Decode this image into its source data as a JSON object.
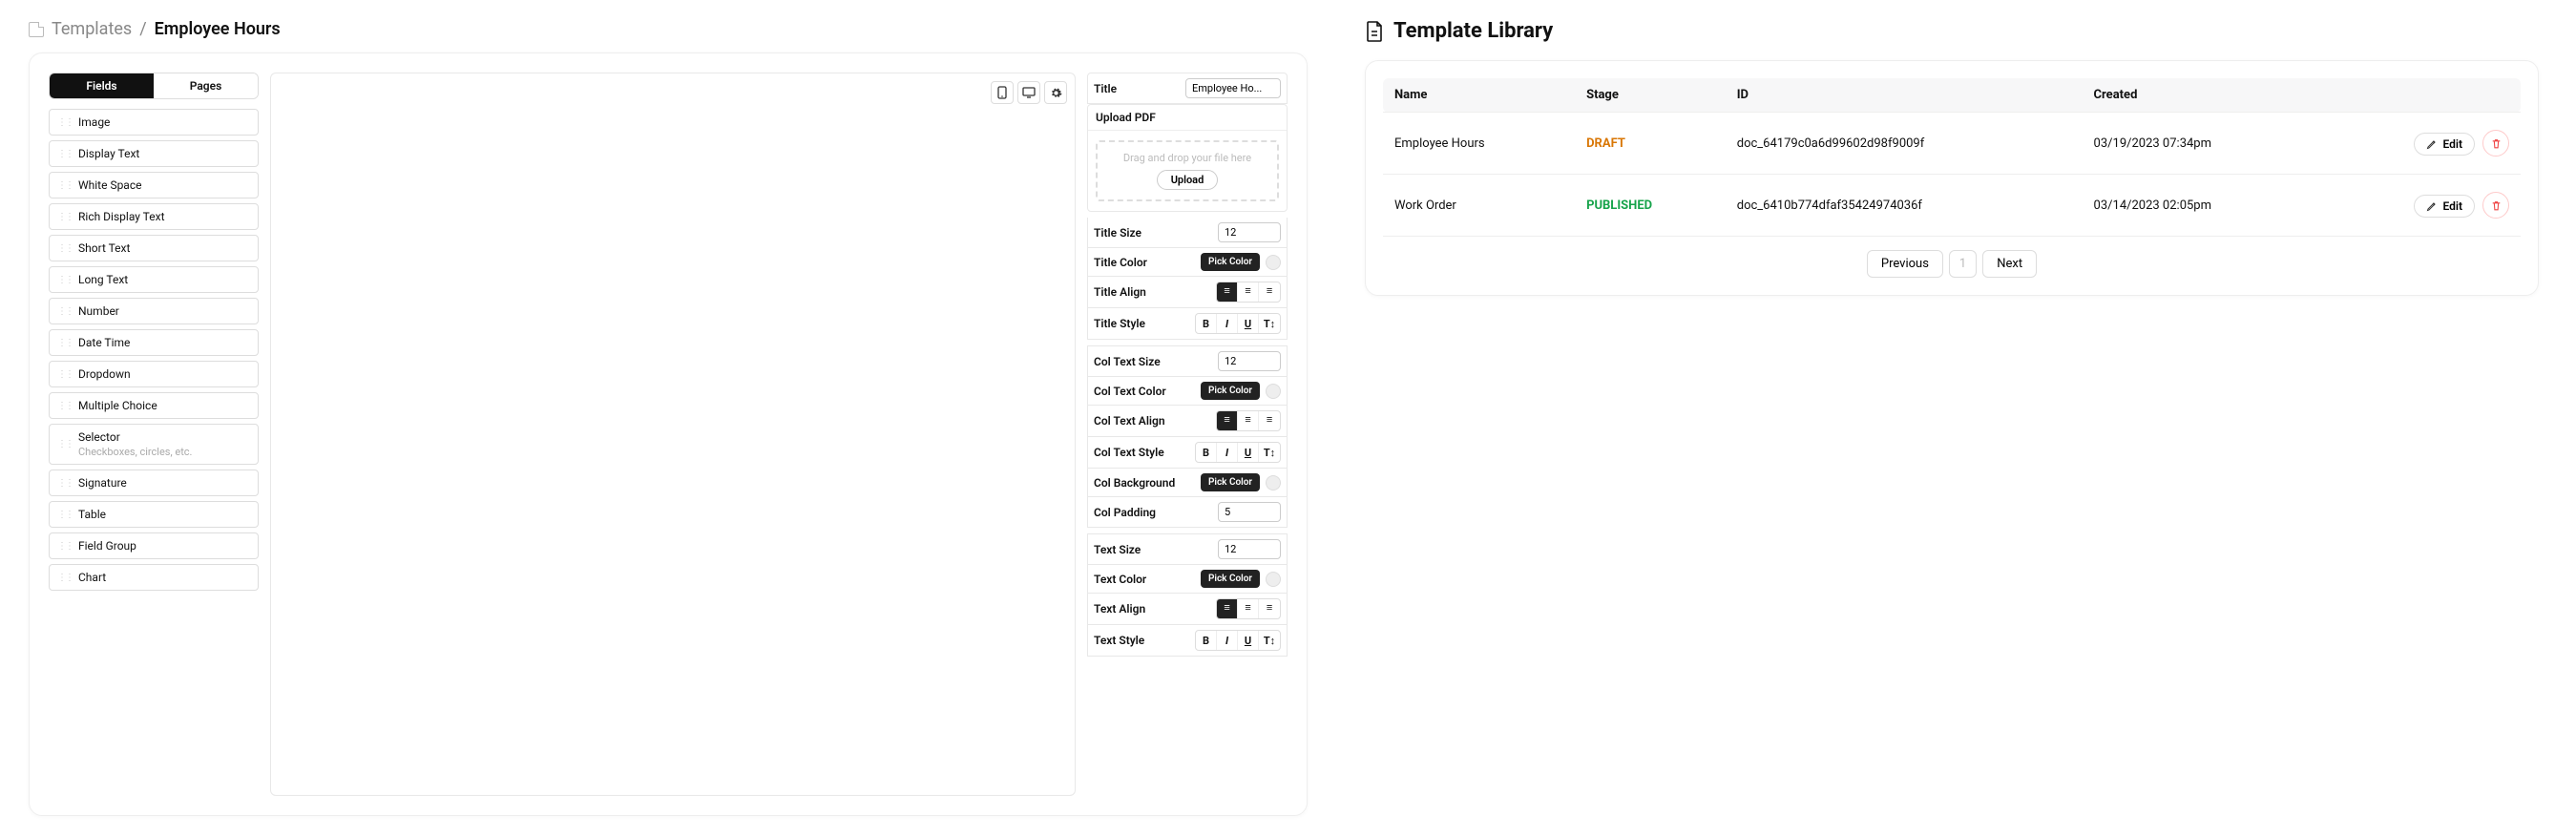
{
  "breadcrumb": {
    "root": "Templates",
    "sep": "/",
    "current": "Employee Hours"
  },
  "tabs": [
    "Fields",
    "Pages"
  ],
  "fields": [
    {
      "label": "Image"
    },
    {
      "label": "Display Text"
    },
    {
      "label": "White Space"
    },
    {
      "label": "Rich Display Text"
    },
    {
      "label": "Short Text"
    },
    {
      "label": "Long Text"
    },
    {
      "label": "Number"
    },
    {
      "label": "Date Time"
    },
    {
      "label": "Dropdown"
    },
    {
      "label": "Multiple Choice"
    },
    {
      "label": "Selector",
      "hint": "Checkboxes, circles, etc."
    },
    {
      "label": "Signature"
    },
    {
      "label": "Table"
    },
    {
      "label": "Field Group"
    },
    {
      "label": "Chart"
    }
  ],
  "props": {
    "title": {
      "label": "Title",
      "value": "Employee Ho..."
    },
    "uploadPdf": {
      "label": "Upload PDF",
      "hint": "Drag and drop your file here",
      "btn": "Upload"
    },
    "titleSize": {
      "label": "Title Size",
      "value": "12"
    },
    "titleColor": {
      "label": "Title Color",
      "btn": "Pick Color"
    },
    "titleAlign": {
      "label": "Title Align"
    },
    "titleStyle": {
      "label": "Title Style"
    },
    "colTextSize": {
      "label": "Col Text Size",
      "value": "12"
    },
    "colTextColor": {
      "label": "Col Text Color",
      "btn": "Pick Color"
    },
    "colTextAlign": {
      "label": "Col Text Align"
    },
    "colTextStyle": {
      "label": "Col Text Style"
    },
    "colBackground": {
      "label": "Col Background",
      "btn": "Pick Color"
    },
    "colPadding": {
      "label": "Col Padding",
      "value": "5"
    },
    "textSize": {
      "label": "Text Size",
      "value": "12"
    },
    "textColor": {
      "label": "Text Color",
      "btn": "Pick Color"
    },
    "textAlign": {
      "label": "Text Align"
    },
    "textStyle": {
      "label": "Text Style"
    }
  },
  "styleBtns": {
    "b": "B",
    "i": "I",
    "u": "U",
    "t": "T↕"
  },
  "library": {
    "title": "Template Library",
    "headers": [
      "Name",
      "Stage",
      "ID",
      "Created",
      ""
    ],
    "rows": [
      {
        "name": "Employee Hours",
        "stage": "DRAFT",
        "stageClass": "stage-draft",
        "id": "doc_64179c0a6d99602d98f9009f",
        "created": "03/19/2023 07:34pm"
      },
      {
        "name": "Work Order",
        "stage": "PUBLISHED",
        "stageClass": "stage-pub",
        "id": "doc_6410b774dfaf35424974036f",
        "created": "03/14/2023 02:05pm"
      }
    ],
    "edit": "Edit",
    "prev": "Previous",
    "page": "1",
    "next": "Next"
  }
}
